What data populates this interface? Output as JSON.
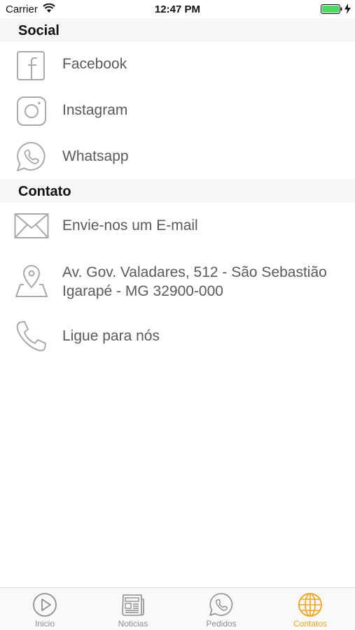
{
  "status_bar": {
    "carrier": "Carrier",
    "time": "12:47 PM"
  },
  "sections": {
    "social": {
      "title": "Social",
      "items": [
        {
          "label": "Facebook",
          "icon": "facebook-icon"
        },
        {
          "label": "Instagram",
          "icon": "instagram-icon"
        },
        {
          "label": "Whatsapp",
          "icon": "whatsapp-icon"
        }
      ]
    },
    "contato": {
      "title": "Contato",
      "items": [
        {
          "label": "Envie-nos um E-mail",
          "icon": "mail-icon"
        },
        {
          "label_line1": " Av. Gov. Valadares, 512 - São Sebastião",
          "label_line2": "Igarapé - MG 32900-000",
          "icon": "map-pin-icon"
        },
        {
          "label": "Ligue para nós",
          "icon": "phone-icon"
        }
      ]
    }
  },
  "tab_bar": {
    "tabs": [
      {
        "label": "Inicio",
        "icon": "play-circle-icon",
        "active": false
      },
      {
        "label": "Noticias",
        "icon": "newspaper-icon",
        "active": false
      },
      {
        "label": "Pedidos",
        "icon": "whatsapp-icon",
        "active": false
      },
      {
        "label": "Contatos",
        "icon": "globe-icon",
        "active": true
      }
    ]
  },
  "colors": {
    "accent": "#f2a216",
    "inactive": "#8e8e8e",
    "icon_gray": "#a9a9a9",
    "text": "#5a5a5a",
    "header_bg": "#f6f6f6"
  }
}
